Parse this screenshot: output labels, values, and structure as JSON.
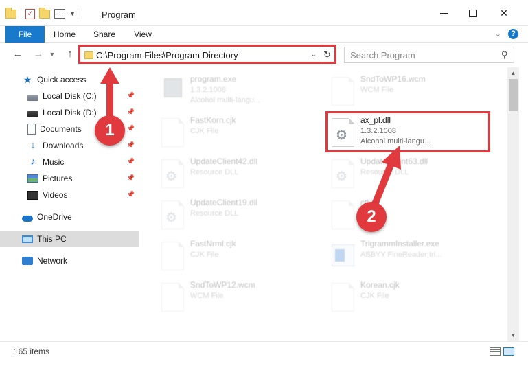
{
  "window": {
    "title": "Program",
    "minimize_icon": "minimize-icon",
    "maximize_icon": "maximize-icon",
    "close_glyph": "✕"
  },
  "ribbon": {
    "tabs": [
      {
        "label": "File",
        "active": true
      },
      {
        "label": "Home"
      },
      {
        "label": "Share"
      },
      {
        "label": "View"
      }
    ],
    "accent_color": "#1979ca",
    "help_glyph": "?"
  },
  "navigation": {
    "back_glyph": "←",
    "forward_glyph": "→",
    "up_glyph": "↑",
    "address_path": "C:\\Program Files\\Program Directory",
    "refresh_glyph": "↻",
    "search_placeholder": "Search Program"
  },
  "sidebar": {
    "items": [
      {
        "label": "Quick access",
        "icon": "star-icon",
        "pinned": false
      },
      {
        "label": "Local Disk (C:)",
        "icon": "drive-icon",
        "pinned": true
      },
      {
        "label": "Local Disk (D:)",
        "icon": "drive-icon",
        "pinned": true
      },
      {
        "label": "Documents",
        "icon": "documents-icon",
        "pinned": true
      },
      {
        "label": "Downloads",
        "icon": "downloads-icon",
        "pinned": true
      },
      {
        "label": "Music",
        "icon": "music-icon",
        "pinned": true
      },
      {
        "label": "Pictures",
        "icon": "pictures-icon",
        "pinned": true
      },
      {
        "label": "Videos",
        "icon": "videos-icon",
        "pinned": true
      },
      {
        "label": "OneDrive",
        "icon": "cloud-icon",
        "pinned": false
      },
      {
        "label": "This PC",
        "icon": "computer-icon",
        "pinned": false,
        "selected": true
      },
      {
        "label": "Network",
        "icon": "network-icon",
        "pinned": false
      }
    ]
  },
  "files": [
    {
      "name": "program.exe",
      "line2": "1.3.2.1008",
      "line3": "Alcohol multi-langu...",
      "icon": "exe-icon",
      "faded": true
    },
    {
      "name": "SndToWP16.wcm",
      "line2": "WCM File",
      "line3": "",
      "icon": "document-icon",
      "faded": true
    },
    {
      "name": "FastKorn.cjk",
      "line2": "CJK File",
      "line3": "",
      "icon": "document-icon",
      "faded": true
    },
    {
      "name": "ax_pl.dll",
      "line2": "1.3.2.1008",
      "line3": "Alcohol multi-langu...",
      "icon": "dll-gear-icon",
      "faded": false
    },
    {
      "name": "UpdateClient42.dll",
      "line2": "Resource DLL",
      "line3": "",
      "icon": "dll-gear-icon",
      "faded": true
    },
    {
      "name": "UpdateClient63.dll",
      "line2": "Resource DLL",
      "line3": "",
      "icon": "dll-gear-icon",
      "faded": true
    },
    {
      "name": "UpdateClient19.dll",
      "line2": "Resource DLL",
      "line3": "",
      "icon": "dll-gear-icon",
      "faded": true
    },
    {
      "name": "ctl.dll",
      "line2": "",
      "line3": "",
      "icon": "document-icon",
      "faded": true
    },
    {
      "name": "FastNrml.cjk",
      "line2": "CJK File",
      "line3": "",
      "icon": "document-icon",
      "faded": true
    },
    {
      "name": "TrigrammInstaller.exe",
      "line2": "ABBYY FineReader tri...",
      "line3": "",
      "icon": "installer-icon",
      "faded": true
    },
    {
      "name": "SndToWP12.wcm",
      "line2": "WCM File",
      "line3": "",
      "icon": "document-icon",
      "faded": true
    },
    {
      "name": "Korean.cjk",
      "line2": "CJK File",
      "line3": "",
      "icon": "document-icon",
      "faded": true
    }
  ],
  "annotations": {
    "step1": "1",
    "step2": "2",
    "color": "#e0393e"
  },
  "status": {
    "item_count": "165 items"
  }
}
